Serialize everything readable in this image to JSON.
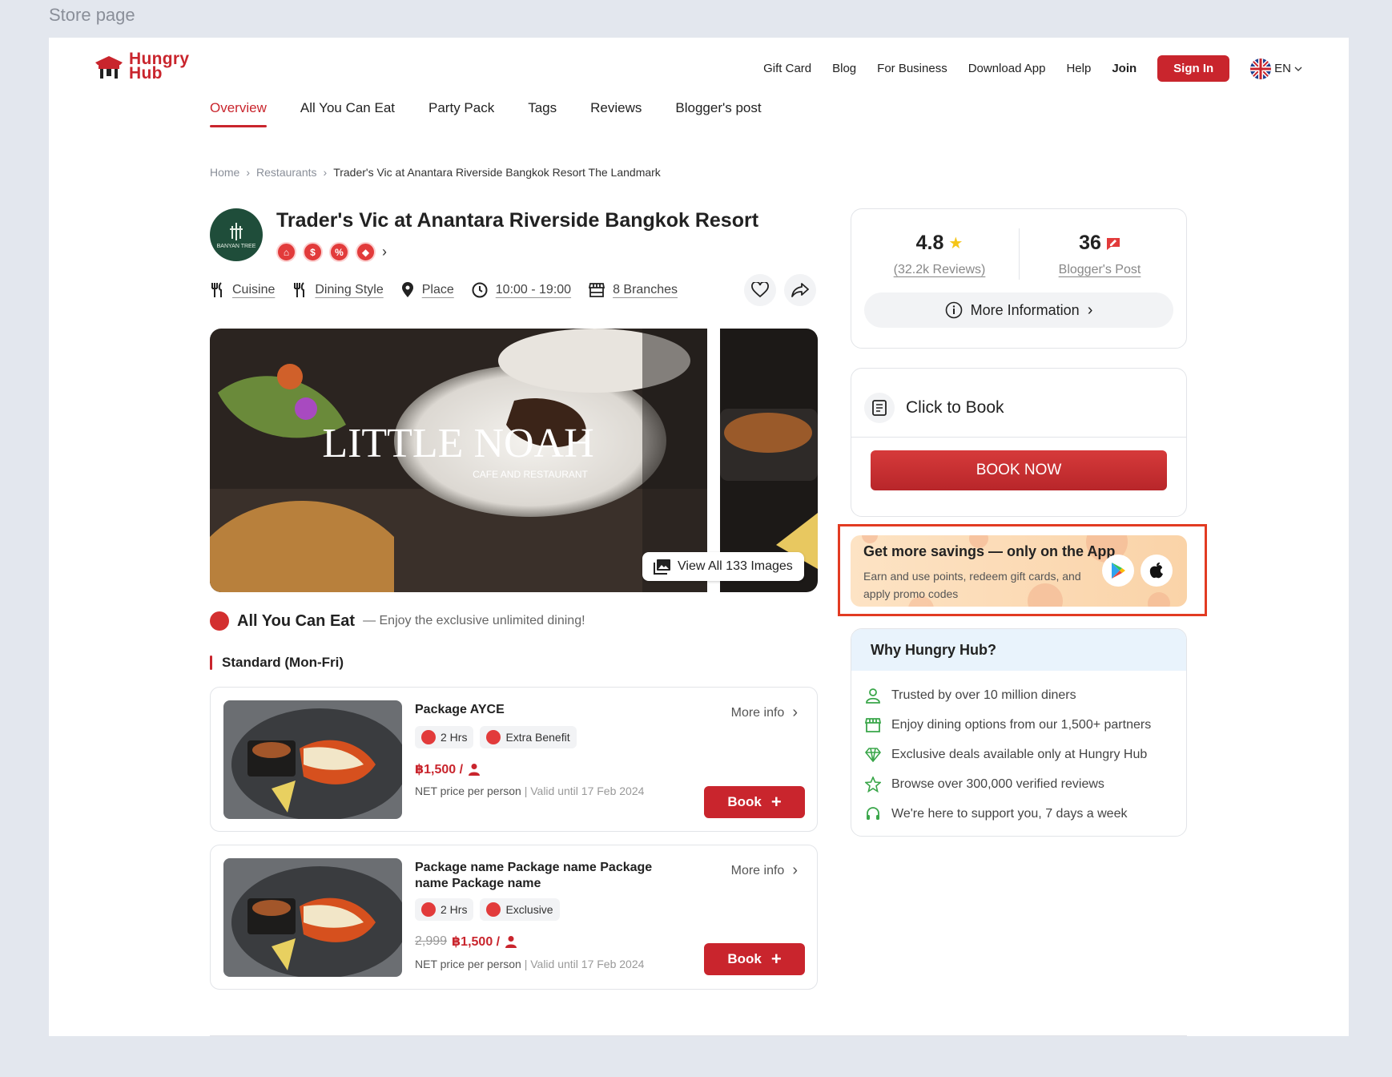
{
  "frame_label": "Store page",
  "brand": {
    "name_line1": "Hungry",
    "name_line2": "Hub",
    "accent": "#c9252d"
  },
  "topnav": {
    "items": [
      "Gift Card",
      "Blog",
      "For Business",
      "Download App",
      "Help"
    ],
    "join": "Join",
    "sign_in": "Sign In",
    "lang": "EN"
  },
  "tabs": [
    "Overview",
    "All You Can Eat",
    "Party Pack",
    "Tags",
    "Reviews",
    "Blogger's post"
  ],
  "active_tab": "Overview",
  "breadcrumb": {
    "home": "Home",
    "restaurants": "Restaurants",
    "current": "Trader's Vic at Anantara Riverside Bangkok Resort The Landmark"
  },
  "restaurant": {
    "avatar_text": "BANYAN TREE",
    "title": "Trader's Vic at Anantara Riverside Bangkok Resort",
    "meta": {
      "cuisine": "Cuisine",
      "dining_style": "Dining Style",
      "place": "Place",
      "hours": "10:00 - 19:00",
      "branches": "8 Branches"
    }
  },
  "gallery": {
    "main_title": "LITTLE NOAH",
    "main_subtitle": "CAFE AND RESTAURANT",
    "view_all": "View All 133 Images"
  },
  "ayce": {
    "title": "All You Can Eat",
    "subtitle": "— Enjoy the exclusive unlimited dining!",
    "group": "Standard (Mon-Fri)"
  },
  "packages": [
    {
      "name": "Package AYCE",
      "more": "More info",
      "chips": [
        "2 Hrs",
        "Extra Benefit"
      ],
      "old_price": "",
      "price": "฿1,500 /",
      "net": "NET price per person",
      "valid": "| Valid until 17 Feb 2024",
      "book": "Book"
    },
    {
      "name": "Package name Package name Package name Package name",
      "more": "More info",
      "chips": [
        "2 Hrs",
        "Exclusive"
      ],
      "old_price": "2,999",
      "price": "฿1,500 /",
      "net": "NET price per person",
      "valid": "| Valid until 17 Feb 2024",
      "book": "Book"
    }
  ],
  "rating": {
    "score": "4.8",
    "reviews": "(32.2k Reviews)",
    "blog_count": "36",
    "blog_label": "Blogger's Post",
    "more_info": "More Information"
  },
  "booking": {
    "title": "Click to Book",
    "button": "BOOK NOW"
  },
  "app_banner": {
    "title": "Get more savings — only on the App",
    "subtitle": "Earn and use points, redeem gift cards, and apply promo codes"
  },
  "why": {
    "title": "Why Hungry Hub?",
    "items": [
      "Trusted by over 10 million diners",
      "Enjoy dining options from our 1,500+ partners",
      "Exclusive deals available only at Hungry Hub",
      "Browse over 300,000 verified reviews",
      "We're here to support you, 7 days a week"
    ]
  }
}
